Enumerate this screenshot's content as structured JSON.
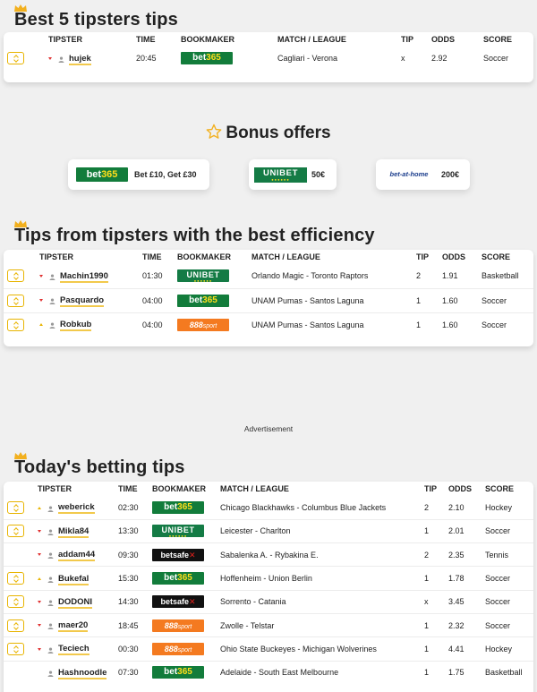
{
  "section1": {
    "title": "Best 5 tipsters tips",
    "headers": [
      "TIPSTER",
      "TIME",
      "BOOKMAKER",
      "MATCH / LEAGUE",
      "TIP",
      "ODDS",
      "SCORE"
    ],
    "rows": [
      {
        "trend": "down",
        "tipster": "hujek",
        "time": "20:45",
        "bookmaker": "bet365",
        "match": "Cagliari - Verona",
        "tip": "x",
        "odds": "2.92",
        "score": "Soccer"
      }
    ]
  },
  "bonus": {
    "title": "Bonus offers",
    "offers": [
      {
        "bookmaker": "bet365",
        "text": "Bet £10, Get £30"
      },
      {
        "bookmaker": "unibet",
        "text": "50€"
      },
      {
        "bookmaker": "bet-at-home",
        "text": "200€"
      }
    ]
  },
  "section2": {
    "title": "Tips from tipsters with the best efficiency",
    "headers": [
      "TIPSTER",
      "TIME",
      "BOOKMAKER",
      "MATCH / LEAGUE",
      "TIP",
      "ODDS",
      "SCORE"
    ],
    "rows": [
      {
        "trend": "down",
        "tipster": "Machin1990",
        "time": "01:30",
        "bookmaker": "unibet",
        "match": "Orlando Magic - Toronto Raptors",
        "tip": "2",
        "odds": "1.91",
        "score": "Basketball"
      },
      {
        "trend": "down",
        "tipster": "Pasquardo",
        "time": "04:00",
        "bookmaker": "bet365",
        "match": "UNAM Pumas - Santos Laguna",
        "tip": "1",
        "odds": "1.60",
        "score": "Soccer"
      },
      {
        "trend": "up",
        "tipster": "Robkub",
        "time": "04:00",
        "bookmaker": "888sport",
        "match": "UNAM Pumas - Santos Laguna",
        "tip": "1",
        "odds": "1.60",
        "score": "Soccer"
      }
    ]
  },
  "advertisement": "Advertisement",
  "section3": {
    "title": "Today's betting tips",
    "headers": [
      "TIPSTER",
      "TIME",
      "BOOKMAKER",
      "MATCH / LEAGUE",
      "TIP",
      "ODDS",
      "SCORE"
    ],
    "rows": [
      {
        "expand": true,
        "trend": "up",
        "tipster": "weberick",
        "time": "02:30",
        "bookmaker": "bet365",
        "match": "Chicago Blackhawks - Columbus Blue Jackets",
        "tip": "2",
        "odds": "2.10",
        "score": "Hockey"
      },
      {
        "expand": true,
        "trend": "down",
        "tipster": "Mikla84",
        "time": "13:30",
        "bookmaker": "unibet",
        "match": "Leicester - Charlton",
        "tip": "1",
        "odds": "2.01",
        "score": "Soccer"
      },
      {
        "expand": false,
        "trend": "down",
        "tipster": "addam44",
        "time": "09:30",
        "bookmaker": "betsafe",
        "match": "Sabalenka A. - Rybakina E.",
        "tip": "2",
        "odds": "2.35",
        "score": "Tennis"
      },
      {
        "expand": true,
        "trend": "up",
        "tipster": "Bukefal",
        "time": "15:30",
        "bookmaker": "bet365",
        "match": "Hoffenheim - Union Berlin",
        "tip": "1",
        "odds": "1.78",
        "score": "Soccer"
      },
      {
        "expand": true,
        "trend": "down",
        "tipster": "DODONI",
        "time": "14:30",
        "bookmaker": "betsafe",
        "match": "Sorrento - Catania",
        "tip": "x",
        "odds": "3.45",
        "score": "Soccer"
      },
      {
        "expand": true,
        "trend": "down",
        "tipster": "maer20",
        "time": "18:45",
        "bookmaker": "888sport",
        "match": "Zwolle - Telstar",
        "tip": "1",
        "odds": "2.32",
        "score": "Soccer"
      },
      {
        "expand": true,
        "trend": "down",
        "tipster": "Teciech",
        "time": "00:30",
        "bookmaker": "888sport",
        "match": "Ohio State Buckeyes - Michigan Wolverines",
        "tip": "1",
        "odds": "4.41",
        "score": "Hockey"
      },
      {
        "expand": false,
        "trend": "none",
        "tipster": "Hashnoodle",
        "time": "07:30",
        "bookmaker": "bet365",
        "match": "Adelaide - South East Melbourne",
        "tip": "1",
        "odds": "1.75",
        "score": "Basketball"
      }
    ]
  },
  "bookmaker_logos": {
    "bet365": {
      "a": "bet",
      "b": "365"
    },
    "unibet": {
      "a": "UNIBET",
      "b": "●●●●●●"
    },
    "888sport": {
      "a": "888",
      "b": "sport"
    },
    "betsafe": {
      "a": "betsafe",
      "b": "✕"
    },
    "bet-at-home": {
      "a": "bet-at-home",
      "b": ""
    }
  },
  "colors": {
    "accent": "#e8b400",
    "underline": "#f2c94c",
    "trend_down": "#e03030",
    "bet365": "#127c3b",
    "unibet": "#147b45",
    "sport888": "#f47a20",
    "betsafe": "#111111"
  },
  "icons": {
    "section": "crown-icon",
    "bonus": "star-icon",
    "tipster": "user-icon",
    "expand": "expand-chevron-icon",
    "trend_down": "trend-down-icon",
    "trend_up": "trend-up-icon"
  }
}
